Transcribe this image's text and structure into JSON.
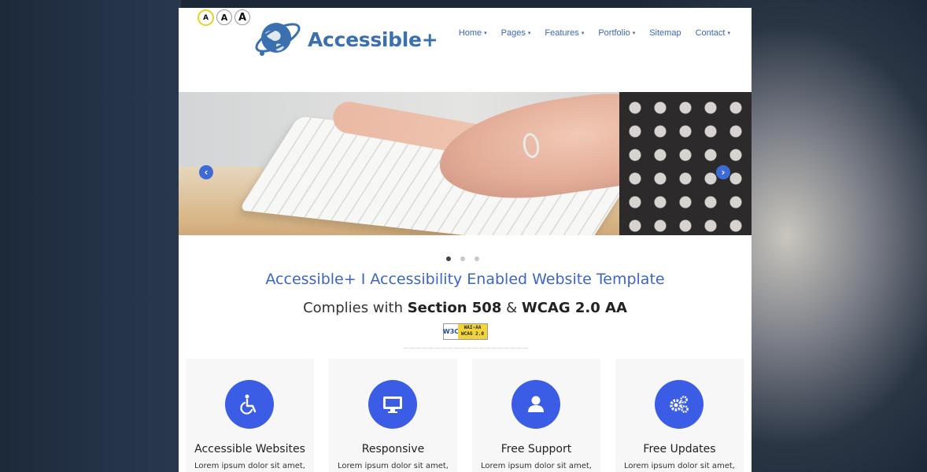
{
  "accessibility_bar": {
    "font_small": "A",
    "font_medium": "A",
    "font_large": "A"
  },
  "logo": {
    "text": "Accessible+",
    "icon": "globe-orbit-icon",
    "color": "#3a6fb0"
  },
  "nav": {
    "items": [
      {
        "label": "Home",
        "has_dropdown": true
      },
      {
        "label": "Pages",
        "has_dropdown": true
      },
      {
        "label": "Features",
        "has_dropdown": true
      },
      {
        "label": "Portfolio",
        "has_dropdown": true
      },
      {
        "label": "Sitemap",
        "has_dropdown": false
      },
      {
        "label": "Contact",
        "has_dropdown": true
      }
    ],
    "caret": "▾",
    "color": "#3b66b8"
  },
  "slider": {
    "prev_arrow": "‹",
    "next_arrow": "›",
    "dots": 3,
    "active_dot": 1
  },
  "hero": {
    "headline": "Accessible+ I Accessibility Enabled Website Template",
    "subhead_prefix": "Complies with ",
    "subhead_section": "Section 508",
    "subhead_amp": " & ",
    "subhead_wcag": "WCAG 2.0 AA"
  },
  "badge": {
    "w3c": "W3C",
    "line1": "WAI-AA",
    "line2": "WCAG 2.0"
  },
  "features": [
    {
      "title": "Accessible Websites",
      "desc": "Lorem ipsum dolor sit amet,",
      "icon": "wheelchair-icon"
    },
    {
      "title": "Responsive",
      "desc": "Lorem ipsum dolor sit amet,",
      "icon": "monitor-icon"
    },
    {
      "title": "Free Support",
      "desc": "Lorem ipsum dolor sit amet,",
      "icon": "user-icon"
    },
    {
      "title": "Free Updates",
      "desc": "Lorem ipsum dolor sit amet,",
      "icon": "gears-icon"
    }
  ],
  "colors": {
    "accent": "#3b5de6",
    "link": "#3b66c4",
    "focus_ring": "#e6d31c"
  }
}
